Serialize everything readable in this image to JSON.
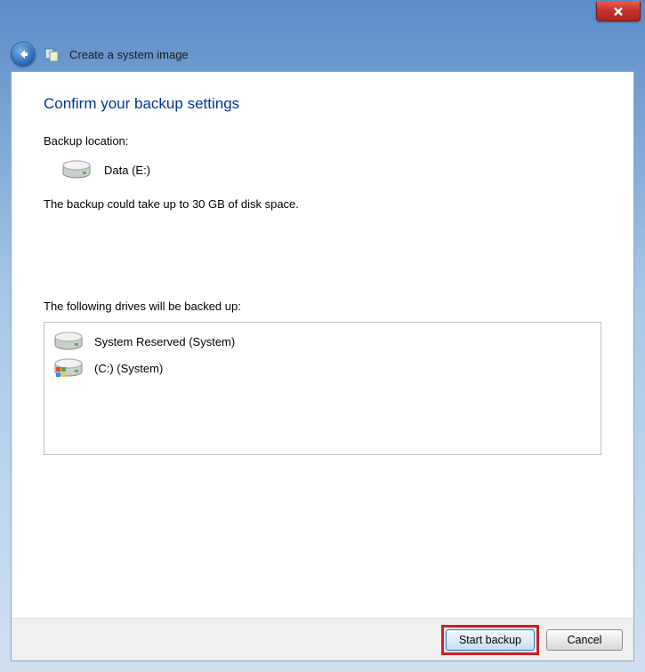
{
  "window": {
    "program_title": "Create a system image"
  },
  "page": {
    "heading": "Confirm your backup settings",
    "backup_location_label": "Backup location:",
    "backup_location_value": "Data (E:)",
    "space_notice": "The backup could take up to 30 GB of disk space.",
    "drives_label": "The following drives will be backed up:",
    "drives": [
      {
        "name": "System Reserved (System)",
        "type": "plain"
      },
      {
        "name": "(C:) (System)",
        "type": "windows"
      }
    ]
  },
  "footer": {
    "start_label": "Start backup",
    "cancel_label": "Cancel"
  }
}
